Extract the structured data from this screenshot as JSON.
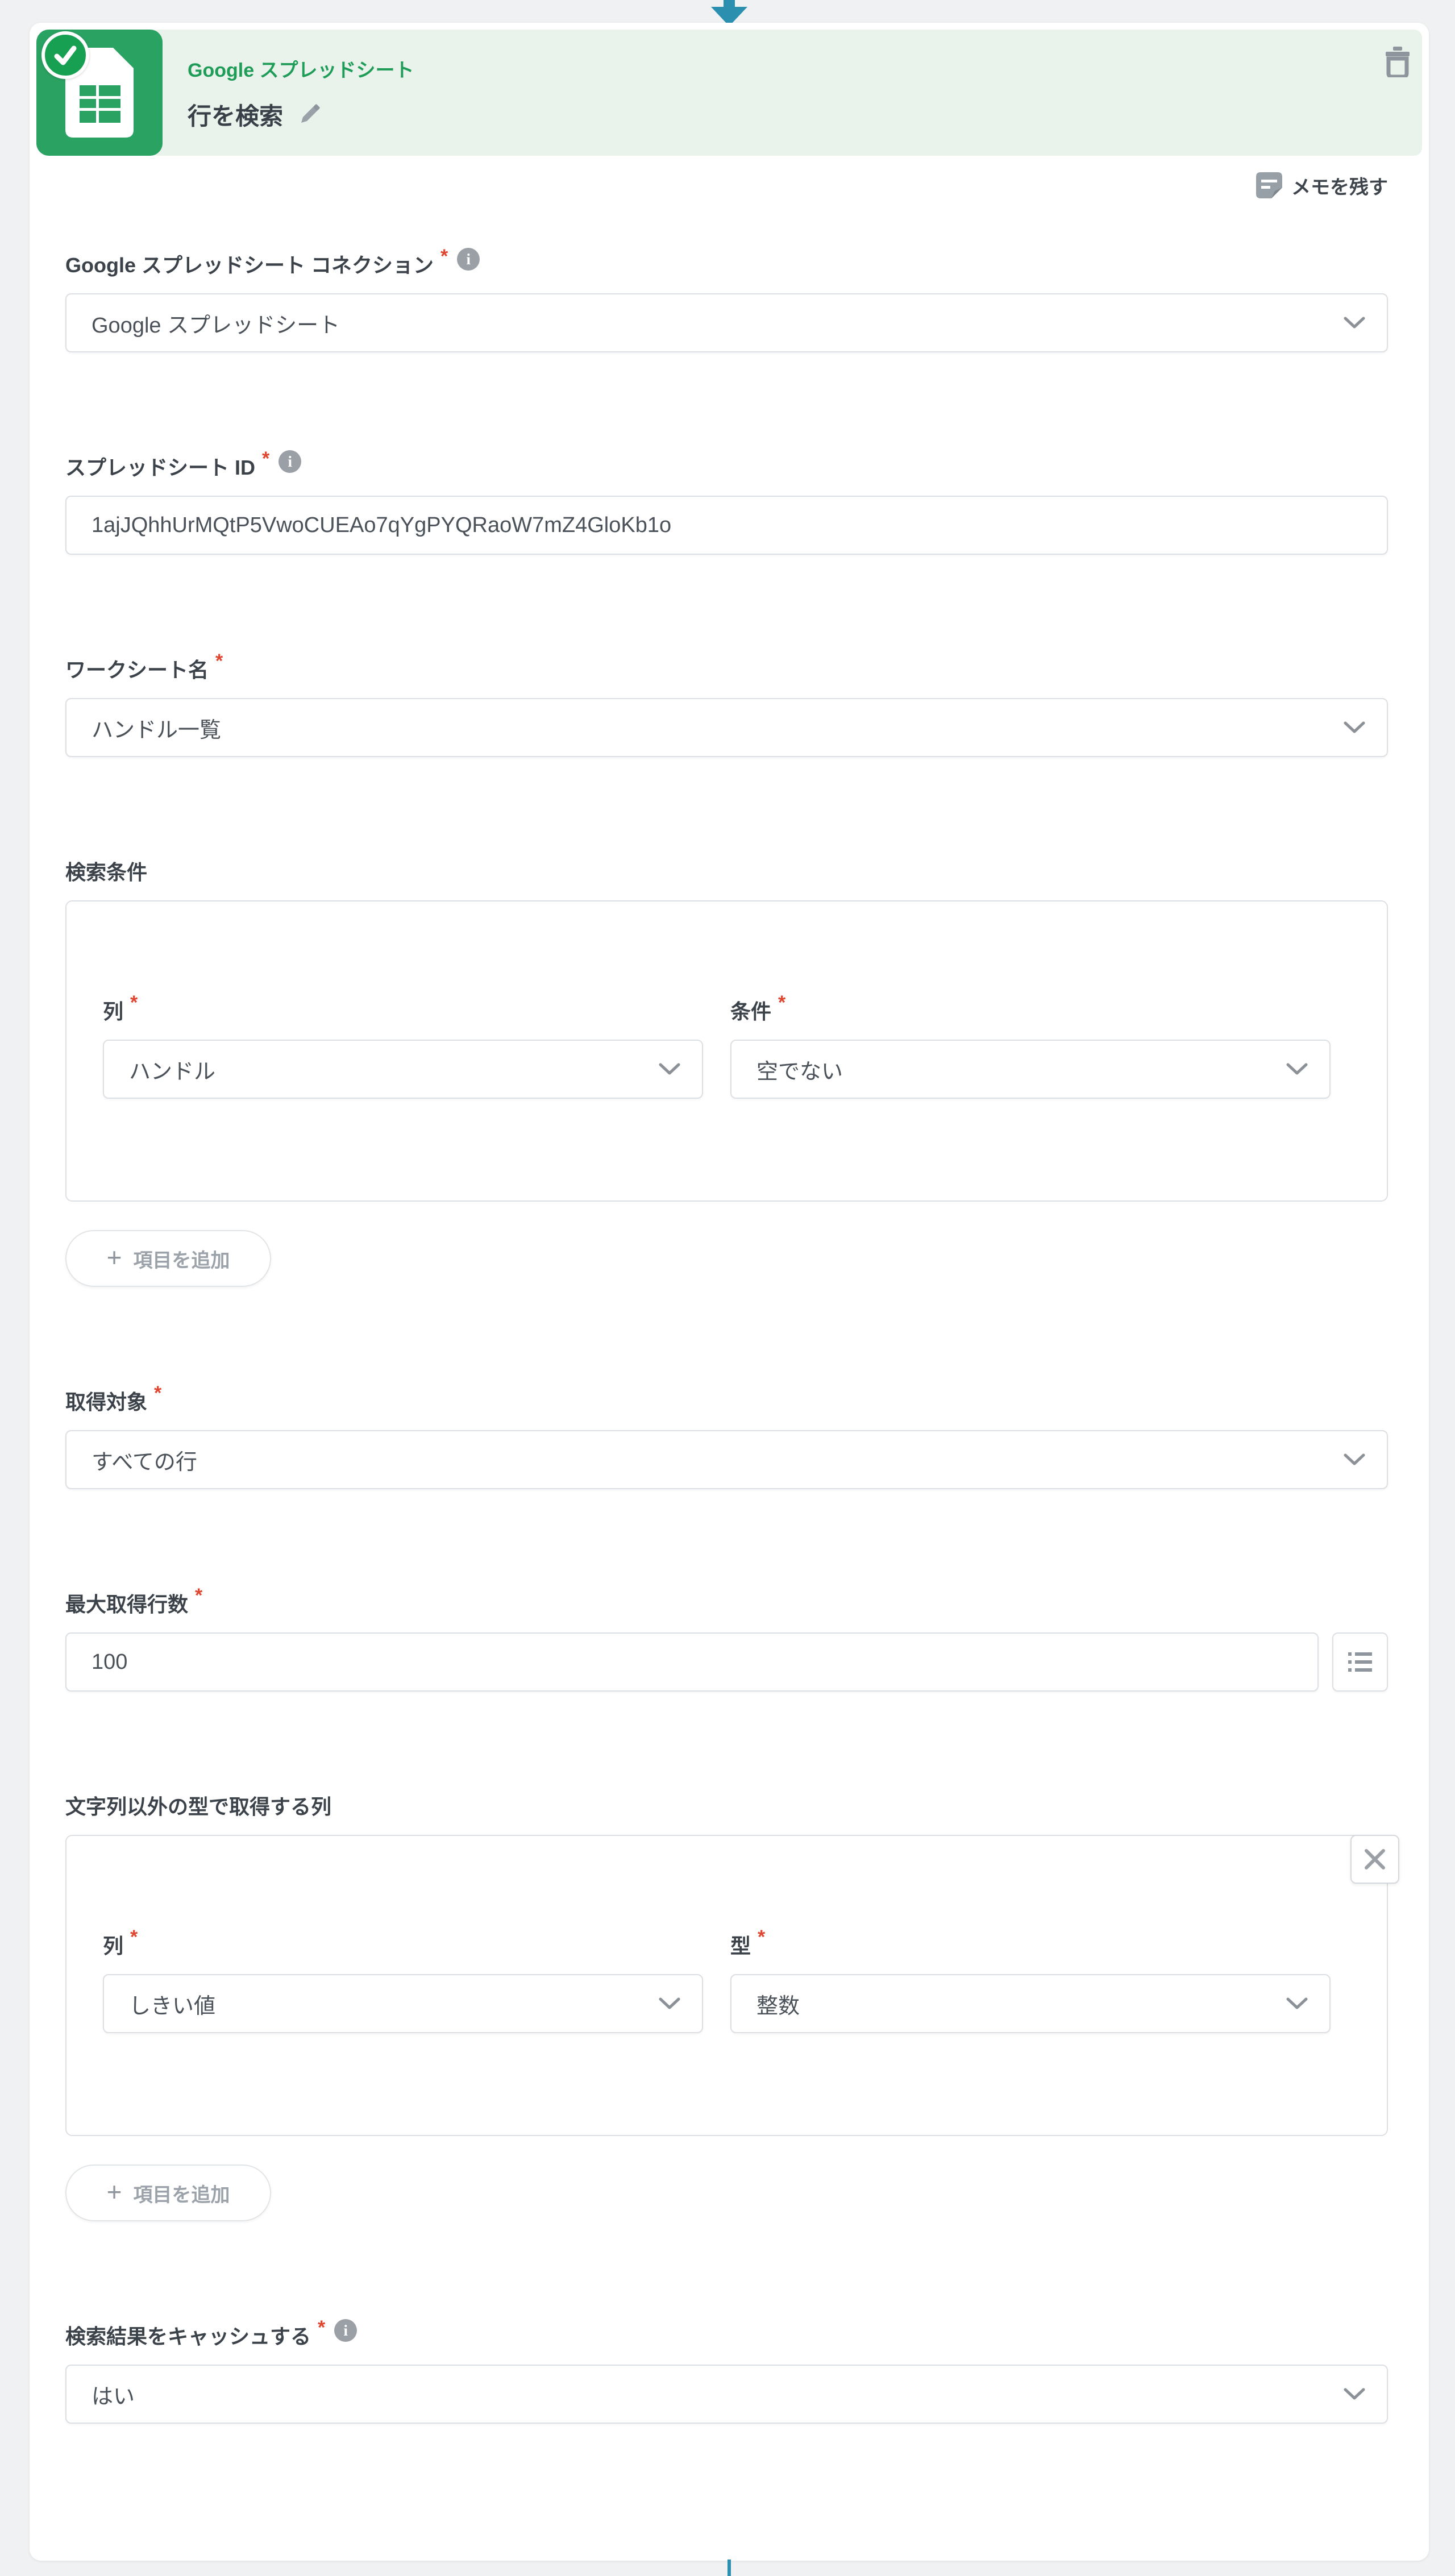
{
  "header": {
    "service": "Google スプレッドシート",
    "title": "行を検索",
    "memo_link": "メモを残す"
  },
  "ui": {
    "required_mark": "*",
    "info_glyph": "i"
  },
  "form": {
    "connection": {
      "label": "Google スプレッドシート コネクション",
      "value": "Google スプレッドシート"
    },
    "sheet_id": {
      "label": "スプレッドシート ID",
      "value": "1ajJQhhUrMQtP5VwoCUEAo7qYgPYQRaoW7mZ4GloKb1o"
    },
    "worksheet": {
      "label": "ワークシート名",
      "value": "ハンドル一覧"
    },
    "search": {
      "label": "検索条件",
      "col_label": "列",
      "cond_label": "条件",
      "rows": [
        {
          "col": "ハンドル",
          "cond": "空でない"
        }
      ],
      "add_button": "項目を追加"
    },
    "target": {
      "label": "取得対象",
      "value": "すべての行"
    },
    "max_rows": {
      "label": "最大取得行数",
      "value": "100"
    },
    "typed_columns": {
      "label": "文字列以外の型で取得する列",
      "col_label": "列",
      "type_label": "型",
      "rows": [
        {
          "col": "しきい値",
          "type": "整数"
        }
      ],
      "add_button": "項目を追加"
    },
    "cache": {
      "label": "検索結果をキャッシュする",
      "value": "はい"
    }
  },
  "colors": {
    "brand_green": "#2AA262",
    "badge_green": "#17A052",
    "service_text_green": "#1F9C57",
    "header_band_bg": "#E9F3EC",
    "connector_teal": "#2B8FB0",
    "required_red": "#E0452F",
    "page_bg": "#EFF1F2"
  },
  "icons": {
    "status": "check-icon",
    "delete_step": "trash-icon",
    "edit_title": "pencil-icon",
    "memo": "note-icon",
    "dropdown": "chevron-down-icon",
    "max_rows_side": "list-icon",
    "remove_group": "close-icon",
    "add_item": "plus-icon"
  }
}
